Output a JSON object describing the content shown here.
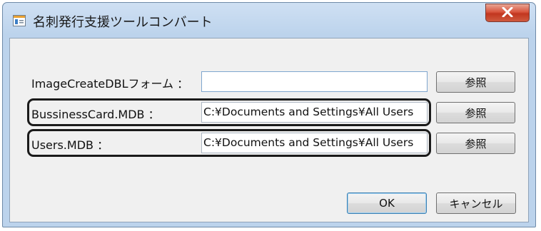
{
  "window": {
    "title": "名刺発行支援ツールコンバート",
    "close_label": "X"
  },
  "form": {
    "rows": [
      {
        "label": "ImageCreateDBLフォーム ：",
        "value": "",
        "browse_label": "参照"
      },
      {
        "label": "BussinessCard.MDB ：",
        "value": "C:¥Documents and Settings¥All Users",
        "browse_label": "参照"
      },
      {
        "label": "Users.MDB ：",
        "value": "C:¥Documents and Settings¥All Users",
        "browse_label": "参照"
      }
    ]
  },
  "buttons": {
    "ok_label": "OK",
    "cancel_label": "キャンセル"
  },
  "colors": {
    "title_bar": "#bcd3ec",
    "client_bg": "#f0f0f0",
    "close_button": "#c2361f",
    "highlight_border": "#1a1a1a"
  },
  "icons": {
    "app": "window-app-icon",
    "close": "close-icon"
  }
}
